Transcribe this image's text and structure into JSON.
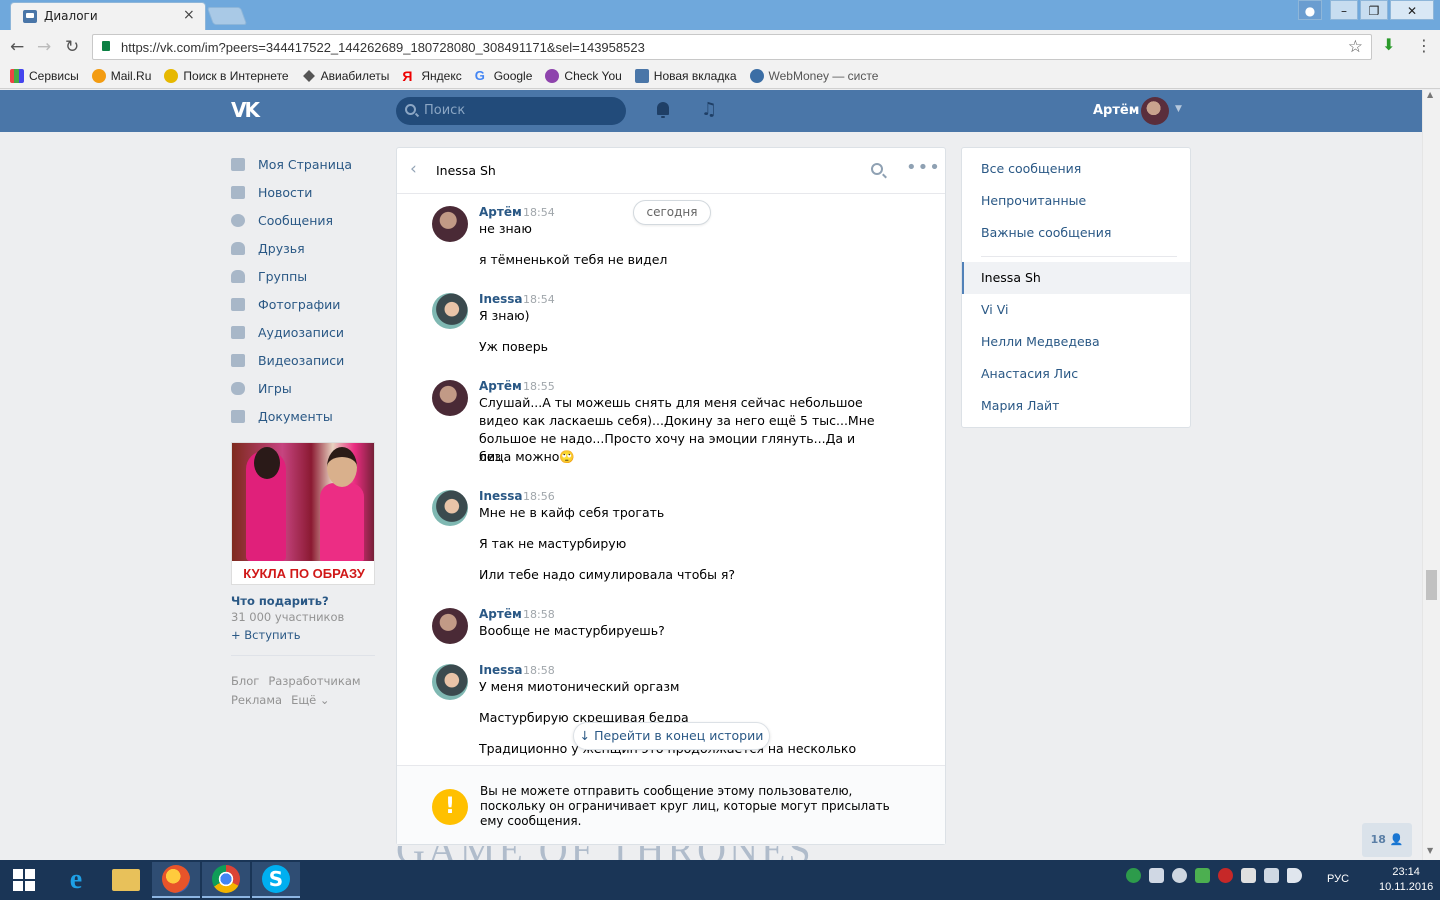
{
  "browser": {
    "tab_title": "Диалоги",
    "tab_close": "×",
    "url": "https://vk.com/im?peers=344417522_144262689_180728080_308491171&sel=143958523",
    "bookmarks": [
      "Сервисы",
      "Mail.Ru",
      "Поиск в Интернете",
      "Авиабилеты",
      "Яндекс",
      "Google",
      "Check You",
      "Новая вкладка",
      "WebMoney — систе"
    ]
  },
  "vk_header": {
    "logo": "VK",
    "search_placeholder": "Поиск",
    "user_name": "Артём"
  },
  "left_menu": {
    "items": [
      "Моя Страница",
      "Новости",
      "Сообщения",
      "Друзья",
      "Группы",
      "Фотографии",
      "Аудиозаписи",
      "Видеозаписи",
      "Игры",
      "Документы"
    ],
    "promo_caption": "КУКЛА ПО ОБРАЗУ",
    "promo_title": "Что подарить?",
    "promo_members": "31 000 участников",
    "promo_join": "+ Вступить",
    "footer": [
      "Блог",
      "Разработчикам",
      "Реклама",
      "Ещё ⌄"
    ]
  },
  "dialog": {
    "name": "Inessa Sh",
    "date_label": "сегодня",
    "messages": [
      {
        "author": "Артём",
        "time": "18:54",
        "lines": [
          "не знаю",
          "я тёмненькой тебя не видел"
        ]
      },
      {
        "author": "Inessa",
        "time": "18:54",
        "lines": [
          "Я знаю)",
          "Уж поверь"
        ]
      },
      {
        "author": "Артём",
        "time": "18:55",
        "lines": [
          "Слушай...А ты можешь снять для меня сейчас небольшое",
          "видео как ласкаешь себя)...Докину за него ещё 5 тыс...Мне",
          "большое не надо...Просто хочу на эмоции глянуть...Да и без",
          "лица можно🙄"
        ]
      },
      {
        "author": "Inessa",
        "time": "18:56",
        "lines": [
          "Мне не в кайф себя трогать",
          "Я так не мастурбирую",
          "Или тебе надо симулировала чтобы я?"
        ]
      },
      {
        "author": "Артём",
        "time": "18:58",
        "lines": [
          "Вообще не мастурбируешь?"
        ]
      },
      {
        "author": "Inessa",
        "time": "18:58",
        "lines": [
          "У меня миотонический оргазм",
          "Мастурбирую скрещивая бедра",
          "Традиционно у женщин это продолжается на несколько"
        ]
      }
    ],
    "jump_label": "↓  Перейти в конец истории",
    "warning_icon": "!",
    "warning_text": "Вы не можете отправить сообщение этому пользователю, поскольку он ограничивает круг лиц, которые могут присылать ему сообщения."
  },
  "right_panel": {
    "filters": [
      "Все сообщения",
      "Непрочитанные",
      "Важные сообщения"
    ],
    "conversations": [
      "Inessa Sh",
      "Vi Vi",
      "Нелли Медведева",
      "Анастасия Лис",
      "Мария Лайт"
    ],
    "active": "Inessa Sh"
  },
  "online_badge": "18",
  "background_banner": "GAME OF THRONES",
  "taskbar": {
    "language": "РУС",
    "time": "23:14",
    "date": "10.11.2016"
  }
}
